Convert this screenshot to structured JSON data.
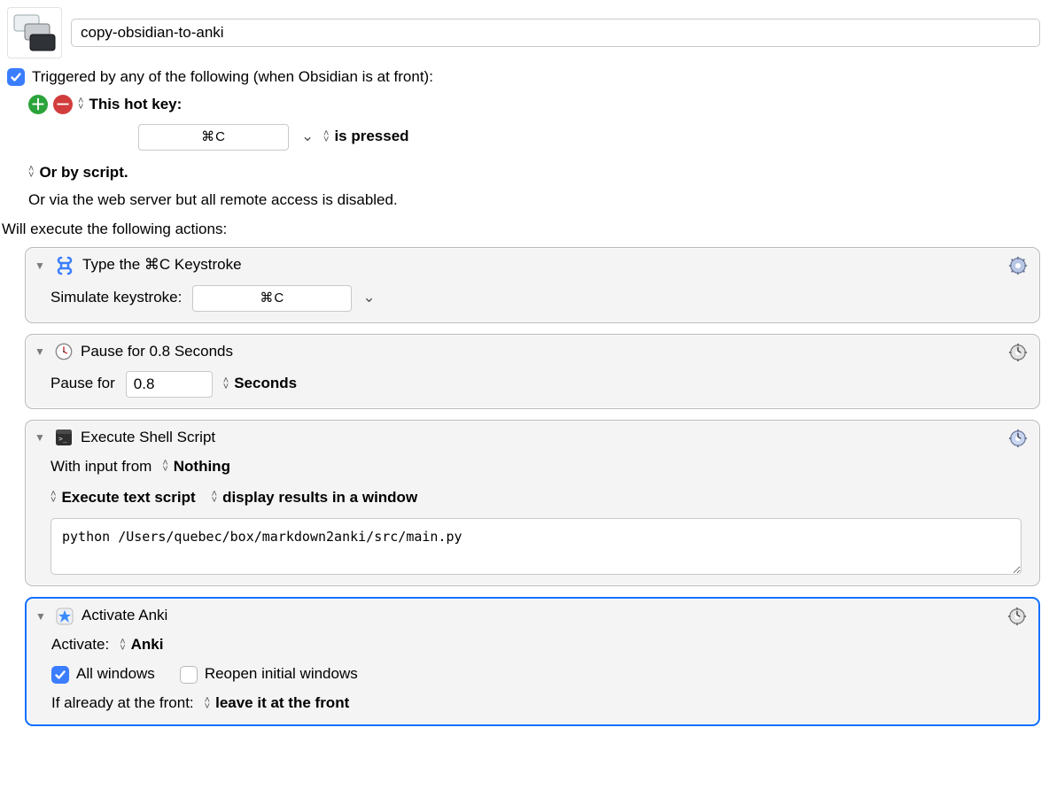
{
  "macro": {
    "name": "copy-obsidian-to-anki"
  },
  "trigger": {
    "enabled_caption": "Triggered by any of the following (when Obsidian is at front):",
    "hotkey_label": "This hot key:",
    "hotkey_value": "⌘C",
    "hotkey_mode": "is pressed",
    "or_script": "Or by script.",
    "or_web": "Or via the web server but all remote access is disabled."
  },
  "actions_label": "Will execute the following actions:",
  "actions": {
    "type_key": {
      "title": "Type the ⌘C Keystroke",
      "field_label": "Simulate keystroke:",
      "keystroke": "⌘C"
    },
    "pause": {
      "title": "Pause for 0.8 Seconds",
      "field_label": "Pause for",
      "value": "0.8",
      "unit": "Seconds"
    },
    "shell": {
      "title": "Execute Shell Script",
      "input_from_label": "With input from",
      "input_from_value": "Nothing",
      "script_mode": "Execute text script",
      "display_mode": "display results in a window",
      "script_text": "python /Users/quebec/box/markdown2anki/src/main.py"
    },
    "activate": {
      "title": "Activate Anki",
      "activate_label": "Activate:",
      "app_name": "Anki",
      "all_windows_label": "All windows",
      "reopen_label": "Reopen initial windows",
      "already_front_label": "If already at the front:",
      "already_front_value": "leave it at the front"
    }
  }
}
